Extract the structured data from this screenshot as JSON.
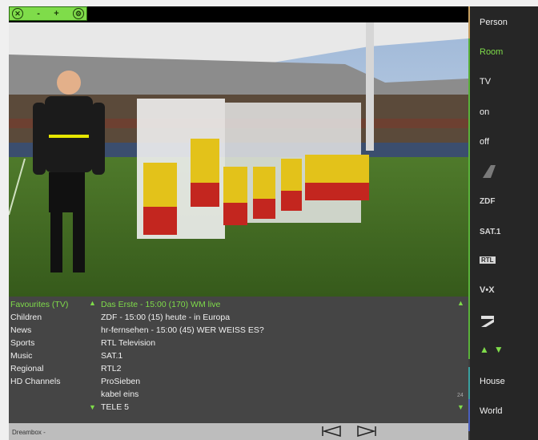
{
  "controls": {
    "close_icon": "close-icon",
    "minus_label": "-",
    "plus_label": "+",
    "settings_icon": "settings-icon"
  },
  "categories": [
    "Favourites (TV)",
    "Children",
    "News",
    "Sports",
    "Music",
    "Regional",
    "HD Channels"
  ],
  "channels": [
    "Das Erste - 15:00 (170) WM live",
    "ZDF - 15:00 (15) heute - in Europa",
    "hr-fernsehen - 15:00 (45) WER WEISS ES?",
    "RTL Television",
    "SAT.1",
    "RTL2",
    "ProSieben",
    "kabel eins",
    "TELE 5"
  ],
  "channel_count": "24",
  "status": {
    "device_name": "Dreambox -"
  },
  "sidebar": {
    "items": [
      "Person",
      "Room",
      "TV",
      "on",
      "off"
    ],
    "logos": [
      "ZDF",
      "SAT.1",
      "RTL",
      "V•X"
    ],
    "house": "House",
    "world": "World"
  },
  "colors": {
    "accent": "#7fdc4a",
    "panel": "#454545",
    "sidebar": "#262626"
  }
}
